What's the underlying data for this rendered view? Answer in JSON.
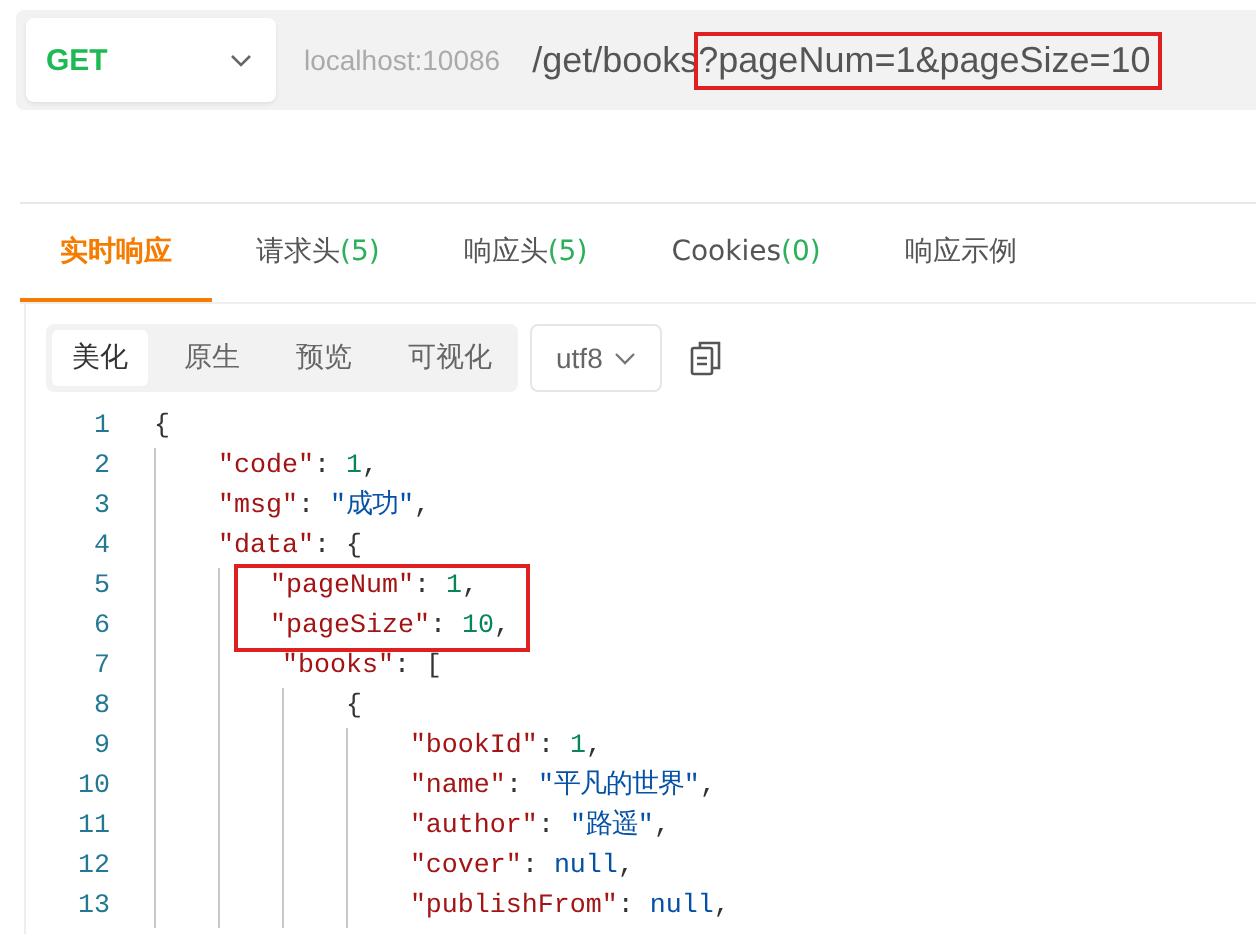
{
  "request": {
    "method": "GET",
    "host": "localhost:10086",
    "path": "/get/books",
    "query": "?pageNum=1&pageSize=10",
    "query_highlighted": true
  },
  "tabs": [
    {
      "label": "实时响应",
      "selected": true
    },
    {
      "label": "请求头",
      "count": "(5)",
      "selected": false
    },
    {
      "label": "响应头",
      "count": "(5)",
      "selected": false
    },
    {
      "label": "Cookies",
      "count": "(0)",
      "selected": false
    },
    {
      "label": "响应示例",
      "selected": false
    }
  ],
  "view_modes": [
    {
      "label": "美化",
      "selected": true
    },
    {
      "label": "原生",
      "selected": false
    },
    {
      "label": "预览",
      "selected": false
    },
    {
      "label": "可视化",
      "selected": false
    }
  ],
  "encoding": "utf8",
  "code_lines": [
    {
      "number": "1",
      "text": "{",
      "highlighted": false
    },
    {
      "number": "2",
      "text": "    \"code\": 1,",
      "highlighted": false
    },
    {
      "number": "3",
      "text": "    \"msg\": \"成功\",",
      "highlighted": false
    },
    {
      "number": "4",
      "text": "    \"data\": {",
      "highlighted": false
    },
    {
      "number": "5",
      "text": "        \"pageNum\": 1,",
      "highlighted": true
    },
    {
      "number": "6",
      "text": "        \"pageSize\": 10,",
      "highlighted": true
    },
    {
      "number": "7",
      "text": "        \"books\": [",
      "highlighted": false
    },
    {
      "number": "8",
      "text": "            {",
      "highlighted": false
    },
    {
      "number": "9",
      "text": "                \"bookId\": 1,",
      "highlighted": false
    },
    {
      "number": "10",
      "text": "                \"name\": \"平凡的世界\",",
      "highlighted": false
    },
    {
      "number": "11",
      "text": "                \"author\": \"路遥\",",
      "highlighted": false
    },
    {
      "number": "12",
      "text": "                \"cover\": null,",
      "highlighted": false
    },
    {
      "number": "13",
      "text": "                \"publishFrom\": null,",
      "highlighted": false
    }
  ]
}
